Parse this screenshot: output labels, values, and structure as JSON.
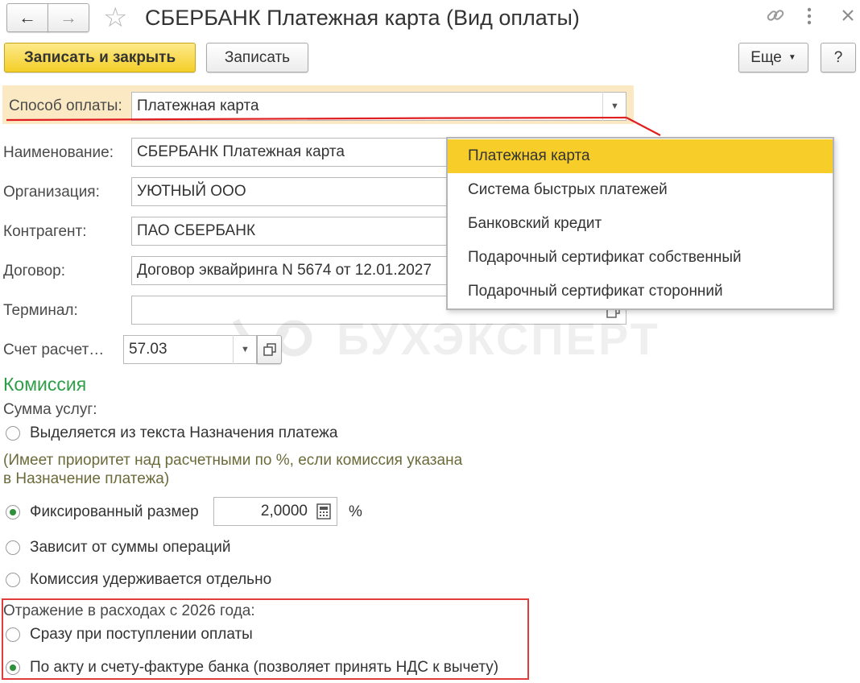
{
  "window": {
    "title": "СБЕРБАНК Платежная карта (Вид оплаты)"
  },
  "toolbar": {
    "save_close_label": "Записать и закрыть",
    "save_label": "Записать",
    "more_label": "Еще",
    "help_label": "?"
  },
  "form": {
    "payment_method": {
      "label": "Способ оплаты:",
      "value": "Платежная карта"
    },
    "name": {
      "label": "Наименование:",
      "value": "СБЕРБАНК Платежная карта"
    },
    "organization": {
      "label": "Организация:",
      "value": "УЮТНЫЙ ООО"
    },
    "counterparty": {
      "label": "Контрагент:",
      "value": "ПАО СБЕРБАНК"
    },
    "contract": {
      "label": "Договор:",
      "value": "Договор эквайринга N 5674 от 12.01.2027"
    },
    "terminal": {
      "label": "Терминал:",
      "value": ""
    },
    "account": {
      "label": "Счет расчет…",
      "value": "57.03"
    }
  },
  "dropdown": {
    "items": [
      {
        "label": "Платежная карта",
        "selected": true
      },
      {
        "label": "Система быстрых платежей",
        "selected": false
      },
      {
        "label": "Банковский кредит",
        "selected": false
      },
      {
        "label": "Подарочный сертификат собственный",
        "selected": false
      },
      {
        "label": "Подарочный сертификат сторонний",
        "selected": false
      }
    ]
  },
  "commission": {
    "heading": "Комиссия",
    "services_label": "Сумма услуг:",
    "option_from_text": "Выделяется из текста Назначения платежа",
    "note_line1": "(Имеет приоритет над расчетными по %, если комиссия указана",
    "note_line2": "в Назначение платежа)",
    "option_fixed": "Фиксированный размер",
    "fixed_value": "2,0000",
    "percent_sign": "%",
    "option_depends": "Зависит от суммы операций",
    "option_separate": "Комиссия удерживается отдельно"
  },
  "expenses": {
    "label": "Отражение в расходах с 2026 года:",
    "option_immediate": "Сразу при поступлении оплаты",
    "option_act": "По акту и счету-фактуре банка (позволяет принять НДС к вычету)"
  },
  "watermark": {
    "text": "БУХЭКСПЕРТ"
  },
  "colors": {
    "accent_yellow": "#f4cf28",
    "highlight_row": "#fbe9c4",
    "heading_green": "#2e9e48",
    "note_olive": "#6b6b3a",
    "annotation_red": "#e02020",
    "radio_green": "#2f8f3a"
  }
}
